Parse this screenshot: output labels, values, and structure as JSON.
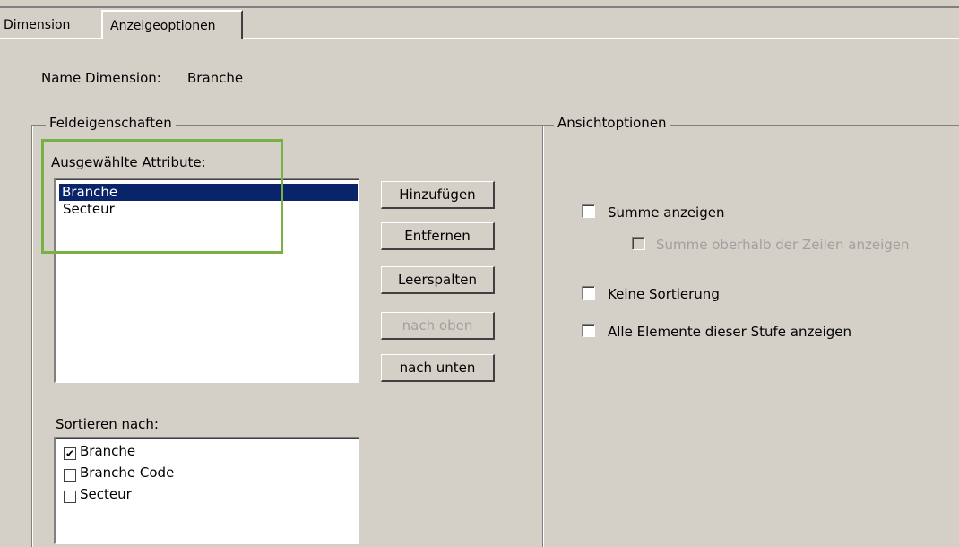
{
  "tabs": {
    "dimension": "Dimension",
    "display_options": "Anzeigeoptionen"
  },
  "header": {
    "name_label": "Name Dimension:",
    "name_value": "Branche"
  },
  "field_properties": {
    "legend": "Feldeigenschaften",
    "selected_attributes_label": "Ausgewählte Attribute:",
    "selected_attributes": [
      "Branche",
      "Secteur"
    ],
    "selected_index": 0,
    "buttons": {
      "add": "Hinzufügen",
      "remove": "Entfernen",
      "empty_columns": "Leerspalten",
      "move_up": "nach oben",
      "move_down": "nach unten"
    },
    "sort_by_label": "Sortieren nach:",
    "sort_items": [
      {
        "label": "Branche",
        "checked": true
      },
      {
        "label": "Branche Code",
        "checked": false
      },
      {
        "label": "Secteur",
        "checked": false
      }
    ]
  },
  "view_options": {
    "legend": "Ansichtoptionen",
    "show_sum": "Summe anzeigen",
    "sum_above_rows": "Summe oberhalb der Zeilen anzeigen",
    "no_sorting": "Keine Sortierung",
    "show_all_elements": "Alle Elemente dieser Stufe anzeigen"
  },
  "colors": {
    "window_bg": "#d4d0c8",
    "selection": "#0a246a",
    "highlight": "#77b043"
  }
}
